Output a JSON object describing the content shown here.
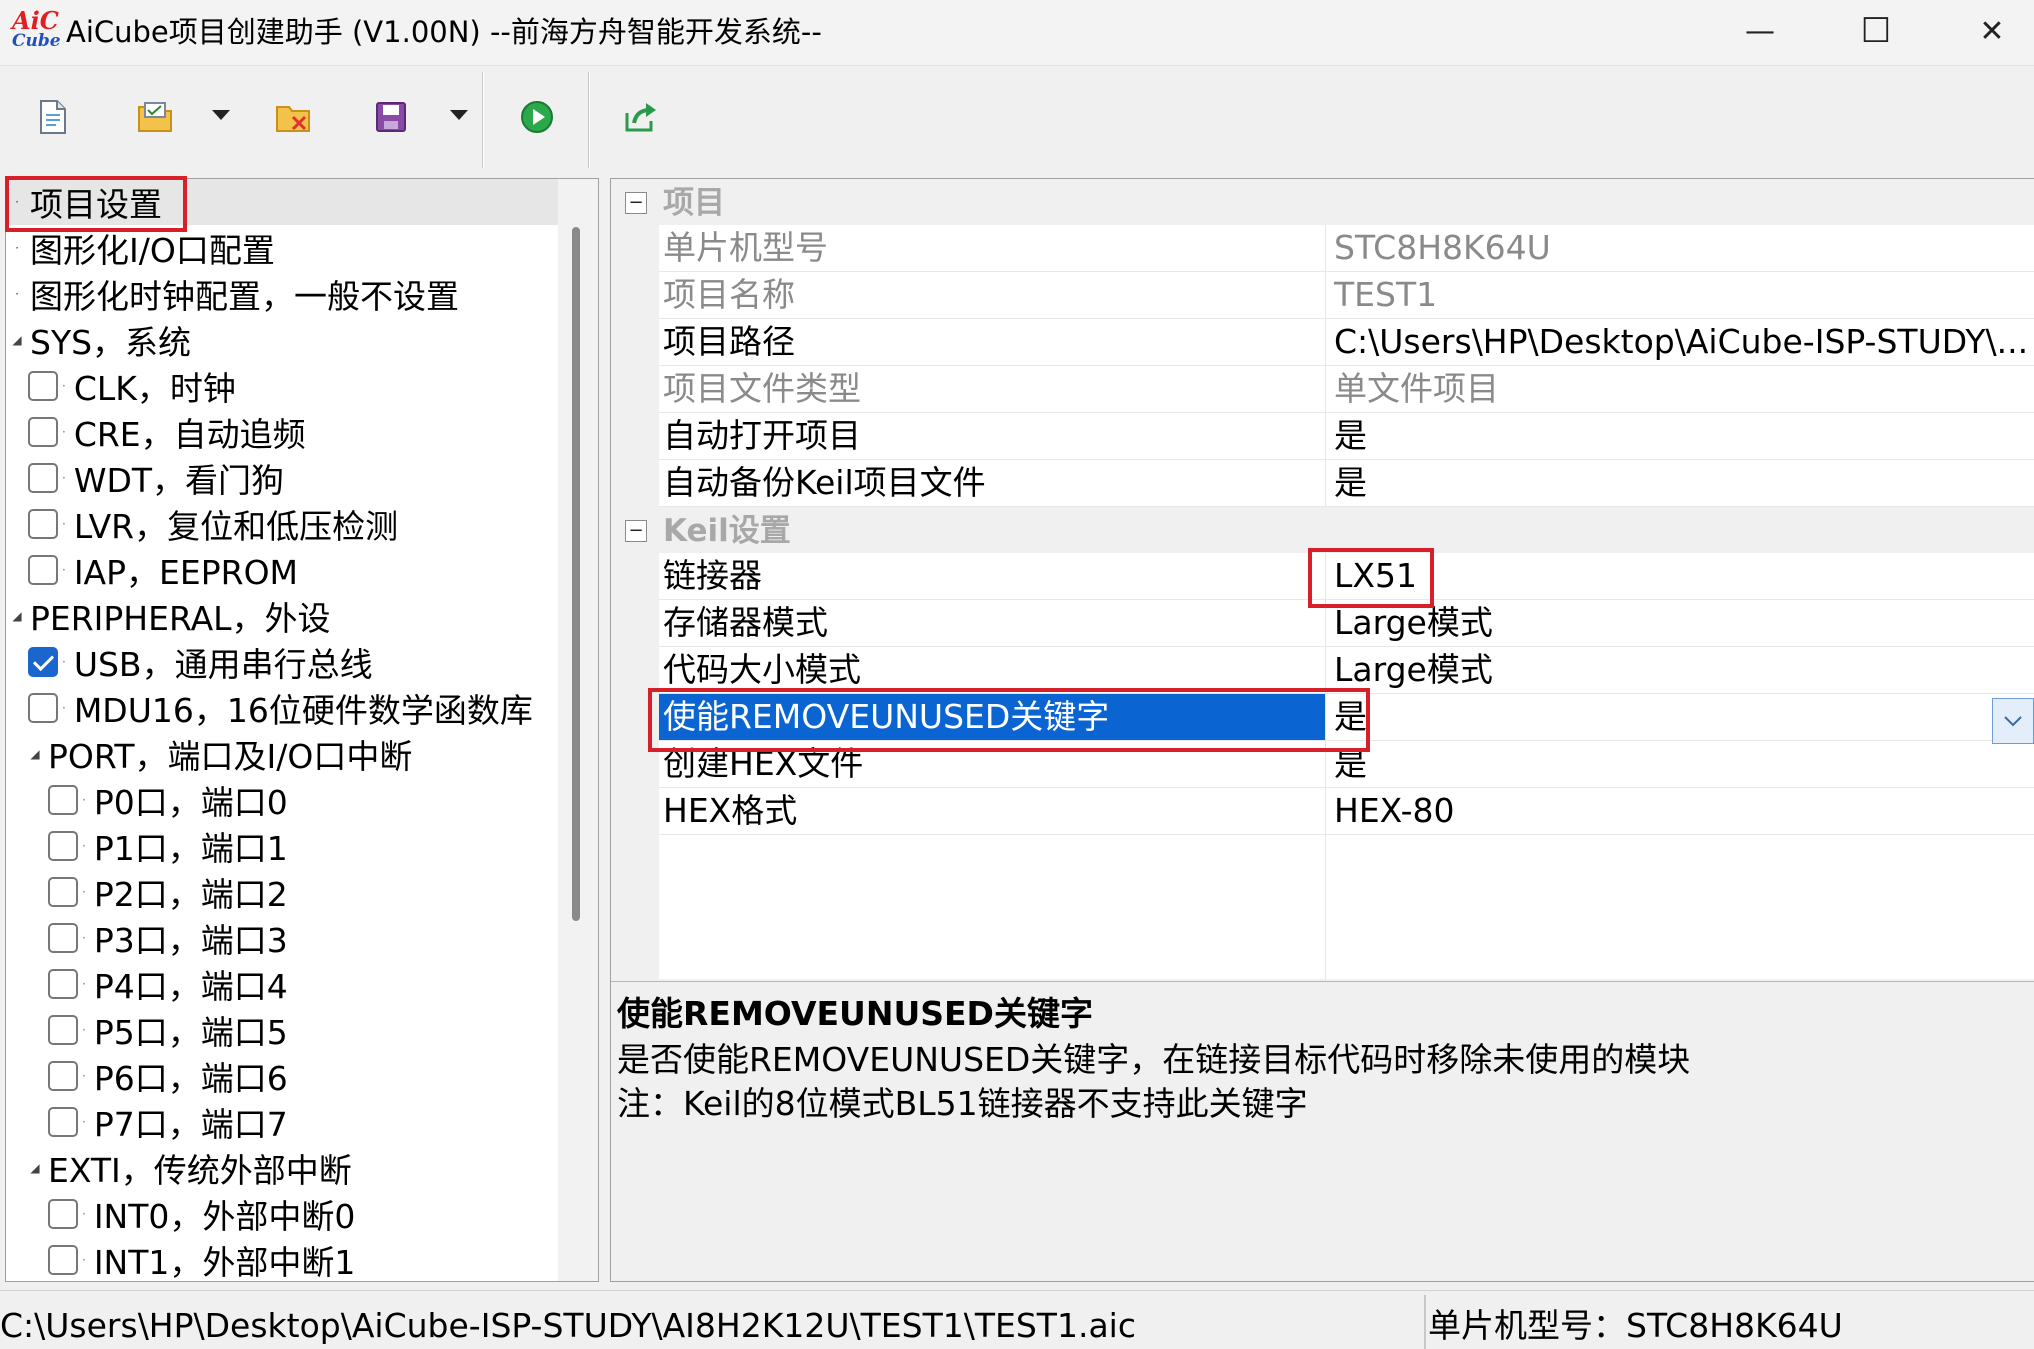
{
  "window": {
    "logo_line1": "AiC",
    "logo_line2": "Cube",
    "title": "AiCube项目创建助手 (V1.00N) --前海方舟智能开发系统--",
    "min_glyph": "—",
    "max_glyph": "☐",
    "close_glyph": "✕"
  },
  "toolbar": {
    "buttons": [
      "new-file-icon",
      "open-project-icon",
      "close-project-icon",
      "save-icon",
      "run-icon",
      "export-icon"
    ]
  },
  "tree": {
    "items": [
      {
        "label": "项目设置",
        "type": "node"
      },
      {
        "label": "图形化I/O口配置",
        "type": "node"
      },
      {
        "label": "图形化时钟配置，一般不设置",
        "type": "node"
      },
      {
        "label": "SYS，系统",
        "type": "group"
      },
      {
        "label": "CLK，时钟",
        "type": "check",
        "checked": false
      },
      {
        "label": "CRE，自动追频",
        "type": "check",
        "checked": false
      },
      {
        "label": "WDT，看门狗",
        "type": "check",
        "checked": false
      },
      {
        "label": "LVR，复位和低压检测",
        "type": "check",
        "checked": false
      },
      {
        "label": "IAP，EEPROM",
        "type": "check",
        "checked": false
      },
      {
        "label": "PERIPHERAL，外设",
        "type": "group"
      },
      {
        "label": "USB，通用串行总线",
        "type": "check",
        "checked": true
      },
      {
        "label": "MDU16，16位硬件数学函数库",
        "type": "check",
        "checked": false
      },
      {
        "label": "PORT，端口及I/O口中断",
        "type": "subgroup"
      },
      {
        "label": "P0口，端口0",
        "type": "subcheck",
        "checked": false
      },
      {
        "label": "P1口，端口1",
        "type": "subcheck",
        "checked": false
      },
      {
        "label": "P2口，端口2",
        "type": "subcheck",
        "checked": false
      },
      {
        "label": "P3口，端口3",
        "type": "subcheck",
        "checked": false
      },
      {
        "label": "P4口，端口4",
        "type": "subcheck",
        "checked": false
      },
      {
        "label": "P5口，端口5",
        "type": "subcheck",
        "checked": false
      },
      {
        "label": "P6口，端口6",
        "type": "subcheck",
        "checked": false
      },
      {
        "label": "P7口，端口7",
        "type": "subcheck",
        "checked": false
      },
      {
        "label": "EXTI，传统外部中断",
        "type": "subgroup"
      },
      {
        "label": "INT0，外部中断0",
        "type": "subcheck",
        "checked": false
      },
      {
        "label": "INT1，外部中断1",
        "type": "subcheck",
        "checked": false
      }
    ]
  },
  "props": {
    "cat_project": "项目",
    "cat_keil": "Keil设置",
    "rows": [
      {
        "name": "单片机型号",
        "value": "STC8H8K64U",
        "readonly": true
      },
      {
        "name": "项目名称",
        "value": "TEST1",
        "readonly": true
      },
      {
        "name": "项目路径",
        "value": "C:\\Users\\HP\\Desktop\\AiCube-ISP-STUDY\\...",
        "readonly": false
      },
      {
        "name": "项目文件类型",
        "value": "单文件项目",
        "readonly": true
      },
      {
        "name": "自动打开项目",
        "value": "是",
        "readonly": false
      },
      {
        "name": "自动备份Keil项目文件",
        "value": "是",
        "readonly": false
      },
      {
        "name": "链接器",
        "value": "LX51",
        "readonly": false
      },
      {
        "name": "存储器模式",
        "value": "Large模式",
        "readonly": false
      },
      {
        "name": "代码大小模式",
        "value": "Large模式",
        "readonly": false
      },
      {
        "name": "使能REMOVEUNUSED关键字",
        "value": "是",
        "readonly": false,
        "selected": true
      },
      {
        "name": "创建HEX文件",
        "value": "是",
        "readonly": false
      },
      {
        "name": "HEX格式",
        "value": "HEX-80",
        "readonly": false
      }
    ]
  },
  "description": {
    "title": "使能REMOVEUNUSED关键字",
    "line1": "是否使能REMOVEUNUSED关键字，在链接目标代码时移除未使用的模块",
    "line2": "注：Keil的8位模式BL51链接器不支持此关键字"
  },
  "status": {
    "path": "C:\\Users\\HP\\Desktop\\AiCube-ISP-STUDY\\AI8H2K12U\\TEST1\\TEST1.aic",
    "chip": "单片机型号：STC8H8K64U"
  },
  "colors": {
    "selection": "#0a64d2",
    "highlight_box": "#d8202a",
    "checkbox_checked": "#1a66cc"
  }
}
